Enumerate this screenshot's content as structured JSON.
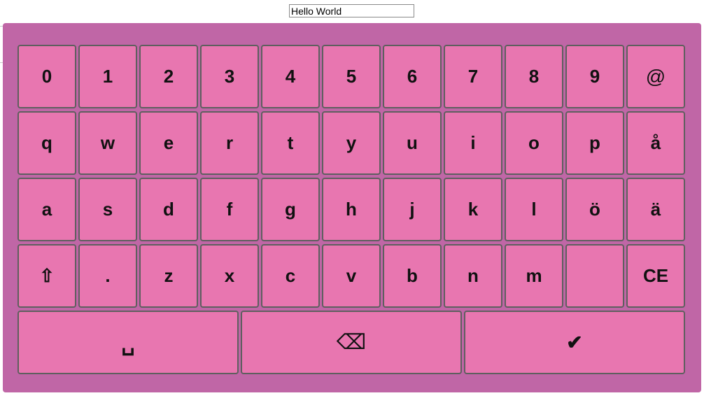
{
  "input": {
    "value": "Hello World"
  },
  "colors": {
    "keyboard_bg": "#c066a6",
    "key_bg": "#e876b0",
    "key_border": "#5f5f5f"
  },
  "keyboard": {
    "rows": [
      [
        "0",
        "1",
        "2",
        "3",
        "4",
        "5",
        "6",
        "7",
        "8",
        "9",
        "@"
      ],
      [
        "q",
        "w",
        "e",
        "r",
        "t",
        "y",
        "u",
        "i",
        "o",
        "p",
        "å"
      ],
      [
        "a",
        "s",
        "d",
        "f",
        "g",
        "h",
        "j",
        "k",
        "l",
        "ö",
        "ä"
      ],
      [
        "⇧",
        ".",
        "z",
        "x",
        "c",
        "v",
        "b",
        "n",
        "m",
        "",
        "CE"
      ]
    ],
    "bottom": {
      "space_label": "␣",
      "backspace_label": "⌫",
      "enter_label": "✔"
    }
  }
}
